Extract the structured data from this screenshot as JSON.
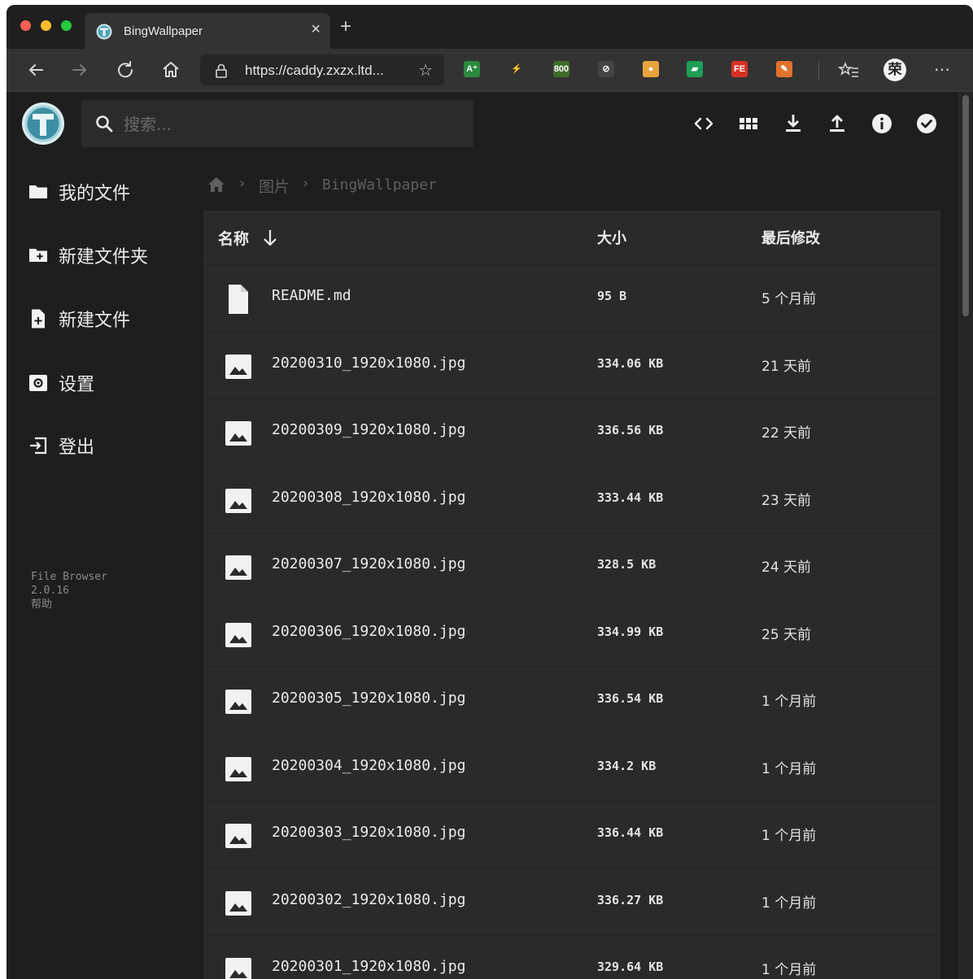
{
  "browser": {
    "tab_title": "BingWallpaper",
    "tab_close": "×",
    "new_tab": "+",
    "url": "https://caddy.zxzx.ltd...",
    "bookmark_star": "☆",
    "extensions": [
      {
        "name": "translate-extension-icon",
        "label": "A⁺",
        "color": "#2b8a3e"
      },
      {
        "name": "lightning-extension-icon",
        "label": "⚡",
        "color": "#333333"
      },
      {
        "name": "counter-extension-icon",
        "label": "800",
        "color": "#3f6b2c"
      },
      {
        "name": "disabled-extension-icon",
        "label": "⊘",
        "color": "#444444"
      },
      {
        "name": "colorball-extension-icon",
        "label": "●",
        "color": "#e8a33d"
      },
      {
        "name": "green-page-extension-icon",
        "label": "▰",
        "color": "#1e9e57"
      },
      {
        "name": "fe-extension-icon",
        "label": "FE",
        "color": "#d93025"
      },
      {
        "name": "palette-extension-icon",
        "label": "✎",
        "color": "#e0732c"
      }
    ],
    "profile_label": "荣",
    "more": "⋯"
  },
  "header": {
    "search_placeholder": "搜索..."
  },
  "sidebar": {
    "items": [
      {
        "label": "我的文件",
        "icon": "folder-icon"
      },
      {
        "label": "新建文件夹",
        "icon": "new-folder-icon"
      },
      {
        "label": "新建文件",
        "icon": "new-file-icon"
      },
      {
        "label": "设置",
        "icon": "settings-icon"
      },
      {
        "label": "登出",
        "icon": "logout-icon"
      }
    ],
    "credits": {
      "app_name": "File Browser",
      "version": "2.0.16",
      "help": "帮助"
    }
  },
  "breadcrumb": {
    "items": [
      "图片",
      "BingWallpaper"
    ]
  },
  "listing": {
    "columns": {
      "name": "名称",
      "size": "大小",
      "modified": "最后修改"
    },
    "rows": [
      {
        "name": "README.md",
        "size": "95 B",
        "modified": "5 个月前",
        "type": "file"
      },
      {
        "name": "20200310_1920x1080.jpg",
        "size": "334.06 KB",
        "modified": "21 天前",
        "type": "image"
      },
      {
        "name": "20200309_1920x1080.jpg",
        "size": "336.56 KB",
        "modified": "22 天前",
        "type": "image"
      },
      {
        "name": "20200308_1920x1080.jpg",
        "size": "333.44 KB",
        "modified": "23 天前",
        "type": "image"
      },
      {
        "name": "20200307_1920x1080.jpg",
        "size": "328.5 KB",
        "modified": "24 天前",
        "type": "image"
      },
      {
        "name": "20200306_1920x1080.jpg",
        "size": "334.99 KB",
        "modified": "25 天前",
        "type": "image"
      },
      {
        "name": "20200305_1920x1080.jpg",
        "size": "336.54 KB",
        "modified": "1 个月前",
        "type": "image"
      },
      {
        "name": "20200304_1920x1080.jpg",
        "size": "334.2 KB",
        "modified": "1 个月前",
        "type": "image"
      },
      {
        "name": "20200303_1920x1080.jpg",
        "size": "336.44 KB",
        "modified": "1 个月前",
        "type": "image"
      },
      {
        "name": "20200302_1920x1080.jpg",
        "size": "336.27 KB",
        "modified": "1 个月前",
        "type": "image"
      },
      {
        "name": "20200301_1920x1080.jpg",
        "size": "329.64 KB",
        "modified": "1 个月前",
        "type": "image"
      }
    ]
  }
}
